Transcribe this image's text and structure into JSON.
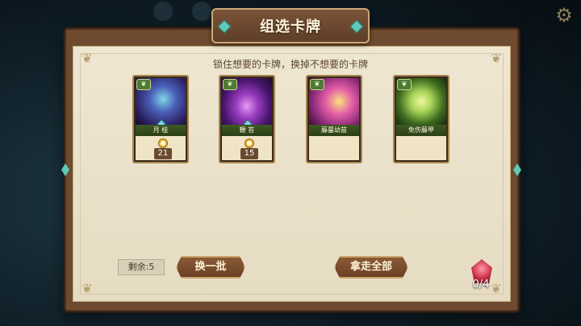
{
  "dialog": {
    "title": "组选卡牌",
    "subtitle": "锁住想要的卡牌，换掉不想要的卡牌"
  },
  "cards": [
    {
      "name": "月 桂",
      "price": "21",
      "type_icon": "plant-icon"
    },
    {
      "name": "鞭 笞",
      "price": "15",
      "type_icon": "plant-icon"
    },
    {
      "name": "藤蔓幼苗",
      "price": "",
      "type_icon": "plant-icon"
    },
    {
      "name": "免伤藤甲",
      "price": "",
      "type_icon": "plant-icon"
    }
  ],
  "footer": {
    "remaining_label": "剩余:5",
    "refresh_button": "换一批",
    "take_all_button": "拿走全部",
    "deck_count": "0/4"
  },
  "colors": {
    "panel_frame": "#6e4a2e",
    "parchment": "#efe6d2",
    "button": "#7a4e2e",
    "accent_gem": "#5fc9b8"
  }
}
